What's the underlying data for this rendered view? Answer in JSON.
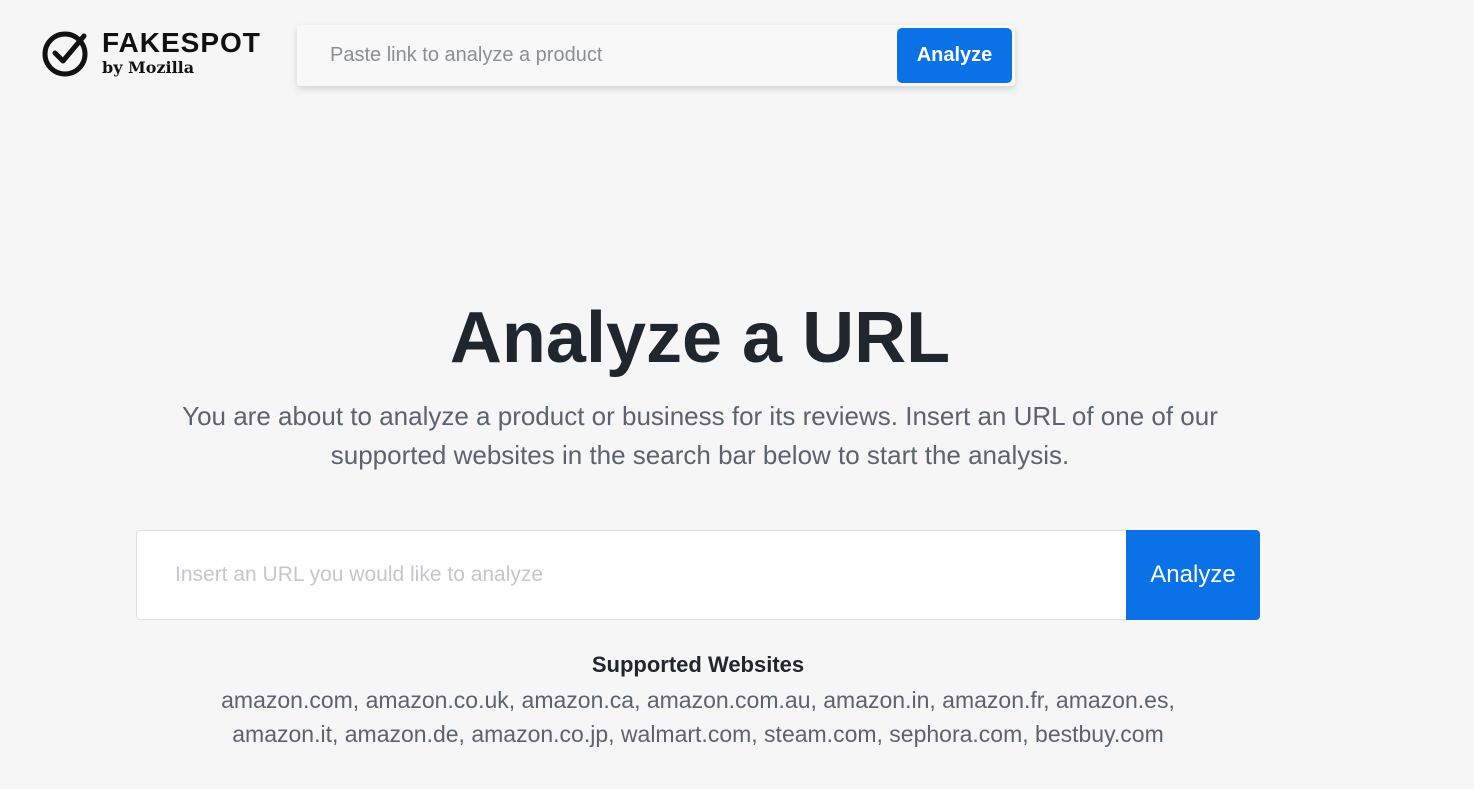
{
  "header": {
    "brand_name": "FAKESPOT",
    "brand_sub": "by Mozilla",
    "logo_icon": "checkmark-circle-icon",
    "search": {
      "placeholder": "Paste link to analyze a product",
      "button_label": "Analyze"
    }
  },
  "hero": {
    "title": "Analyze a URL",
    "description": "You are about to analyze a product or business for its reviews. Insert an URL of one of our supported websites in the search bar below to start the analysis."
  },
  "main_search": {
    "placeholder": "Insert an URL you would like to analyze",
    "button_label": "Analyze"
  },
  "supported": {
    "title": "Supported Websites",
    "sites": "amazon.com, amazon.co.uk, amazon.ca, amazon.com.au, amazon.in, amazon.fr, amazon.es, amazon.it, amazon.de, amazon.co.jp, walmart.com, steam.com, sephora.com, bestbuy.com"
  },
  "colors": {
    "accent": "#0a72e6",
    "background": "#f6f6f6",
    "heading": "#20262d",
    "body_text": "#5b6370"
  }
}
